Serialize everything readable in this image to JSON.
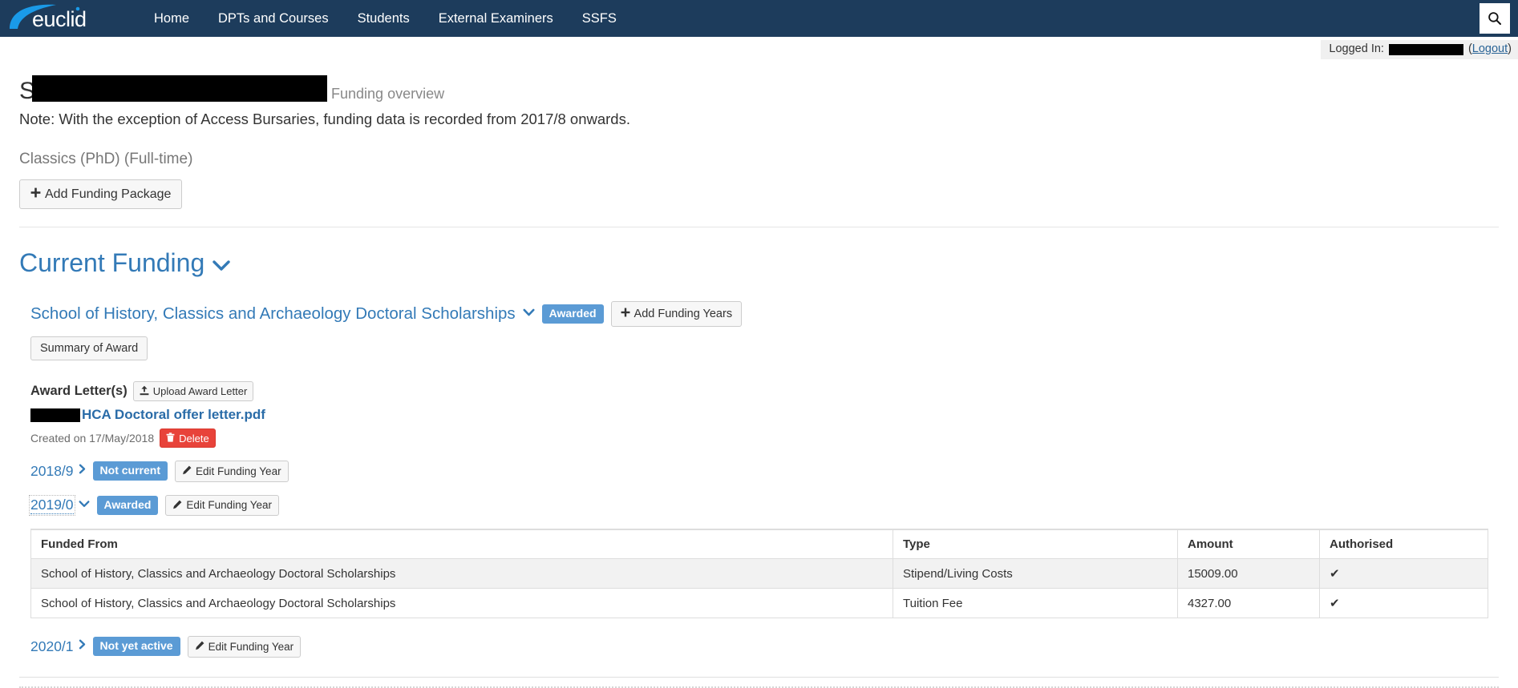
{
  "navbar": {
    "brand": "euclid",
    "brand_icon": "euclid-logo",
    "links": [
      {
        "label": "Home",
        "name": "nav-link-home"
      },
      {
        "label": "DPTs and Courses",
        "name": "nav-link-dpts-and-courses"
      },
      {
        "label": "Students",
        "name": "nav-link-students"
      },
      {
        "label": "External Examiners",
        "name": "nav-link-external-examiners"
      },
      {
        "label": "SSFS",
        "name": "nav-link-ssfs"
      }
    ],
    "search_icon": "search-icon",
    "colors": {
      "navbar_bg": "#1d3c5c",
      "logo_blue": "#1a9ae8"
    }
  },
  "loginbar": {
    "label": "Logged In:",
    "user": "",
    "logout_open": "(",
    "logout": "Logout",
    "logout_close": ")"
  },
  "header": {
    "title_prefix": "S",
    "title_redacted": "",
    "subtitle": "Funding overview",
    "note": "Note: With the exception of Access Bursaries, funding data is recorded from 2017/8 onwards.",
    "programme": "Classics (PhD) (Full-time)",
    "add_funding_package": "Add Funding Package",
    "add_icon": "plus-icon"
  },
  "current_funding": {
    "heading": "Current Funding",
    "heading_chevron": "chevron-down-icon",
    "award": {
      "title": "School of History, Classics and Archaeology Doctoral Scholarships",
      "title_chevron": "chevron-down-icon",
      "status_badge": "Awarded",
      "add_funding_years": "Add Funding Years",
      "add_icon": "plus-icon",
      "summary_of_award": "Summary of Award",
      "award_letters_label": "Award Letter(s)",
      "upload_award_letter": "Upload Award Letter",
      "upload_icon": "upload-icon",
      "letter_redacted": "",
      "letter_filename": "HCA Doctoral offer letter.pdf",
      "created_text": "Created on 17/May/2018",
      "delete_label": "Delete",
      "delete_icon": "trash-icon"
    },
    "years": [
      {
        "label": "2018/9",
        "chevron": "chevron-right-icon",
        "badge": "Not current",
        "edit_label": "Edit Funding Year",
        "edit_icon": "pencil-icon",
        "expanded": false,
        "active": false
      },
      {
        "label": "2019/0",
        "chevron": "chevron-down-icon",
        "badge": "Awarded",
        "edit_label": "Edit Funding Year",
        "edit_icon": "pencil-icon",
        "expanded": true,
        "active": true
      },
      {
        "label": "2020/1",
        "chevron": "chevron-right-icon",
        "badge": "Not yet active",
        "edit_label": "Edit Funding Year",
        "edit_icon": "pencil-icon",
        "expanded": false,
        "active": false
      }
    ],
    "table": {
      "headers": [
        "Funded From",
        "Type",
        "Amount",
        "Authorised"
      ],
      "rows": [
        {
          "funded_from": "School of History, Classics and Archaeology Doctoral Scholarships",
          "type": "Stipend/Living Costs",
          "amount": "15009.00",
          "authorised": "✔"
        },
        {
          "funded_from": "School of History, Classics and Archaeology Doctoral Scholarships",
          "type": "Tuition Fee",
          "amount": "4327.00",
          "authorised": "✔"
        }
      ]
    }
  },
  "colors": {
    "link_blue": "#337ab7",
    "badge_blue": "#5b9bd5",
    "danger_red": "#e8433a",
    "table_alt_row": "#f2f2f2"
  }
}
